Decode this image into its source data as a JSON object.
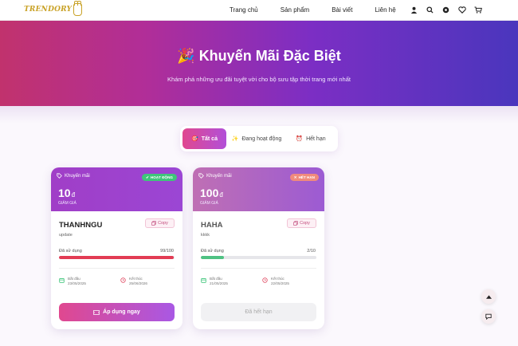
{
  "brand": {
    "logo_text": "TRENDORY"
  },
  "nav": {
    "items": [
      "Trang chủ",
      "Sản phẩm",
      "Bài viết",
      "Liên hệ"
    ],
    "icons": [
      "user-icon",
      "search-icon",
      "settings-icon",
      "heart-icon",
      "cart-icon"
    ]
  },
  "hero": {
    "emoji": "🎉",
    "title": "Khuyến Mãi Đặc Biệt",
    "subtitle": "Khám phá những ưu đãi tuyệt vời cho bộ sưu tập thời trang mới nhất"
  },
  "filters": [
    {
      "icon": "🎯",
      "label": "Tất cả",
      "active": true
    },
    {
      "icon": "✨",
      "label": "Đang hoạt động",
      "active": false
    },
    {
      "icon": "⏰",
      "label": "Hết hạn",
      "active": false
    }
  ],
  "coupons": [
    {
      "type_label": "Khuyến mãi",
      "status": "HOẠT ĐỘNG",
      "value": "10",
      "currency": "đ",
      "value_label": "GIẢM GIÁ",
      "code": "THANHNGU",
      "copy_label": "Copy",
      "description": "update",
      "usage_label": "Đã sử dụng",
      "usage_text": "99/100",
      "usage_fraction": 0.99,
      "start_label": "Bắt đầu",
      "start_date": "23/05/2025",
      "end_label": "Kết thúc",
      "end_date": "25/06/2026",
      "button_label": "Áp dụng ngay"
    },
    {
      "type_label": "Khuyến mãi",
      "status": "HẾT HẠN",
      "value": "100",
      "currency": "đ",
      "value_label": "GIẢM GIÁ",
      "code": "HAHA",
      "copy_label": "Copy",
      "description": "kkkk",
      "usage_label": "Đã sử dụng",
      "usage_text": "2/10",
      "usage_fraction": 0.2,
      "start_label": "Bắt đầu",
      "start_date": "21/05/2025",
      "end_label": "Kết thúc",
      "end_date": "22/05/2025",
      "button_label": "Đã hết hạn"
    }
  ],
  "colors": {
    "accent_pink": "#e0488f",
    "accent_purple": "#9b46d4",
    "active_green": "#3ec57a",
    "expired_coral": "#f08a7c"
  }
}
